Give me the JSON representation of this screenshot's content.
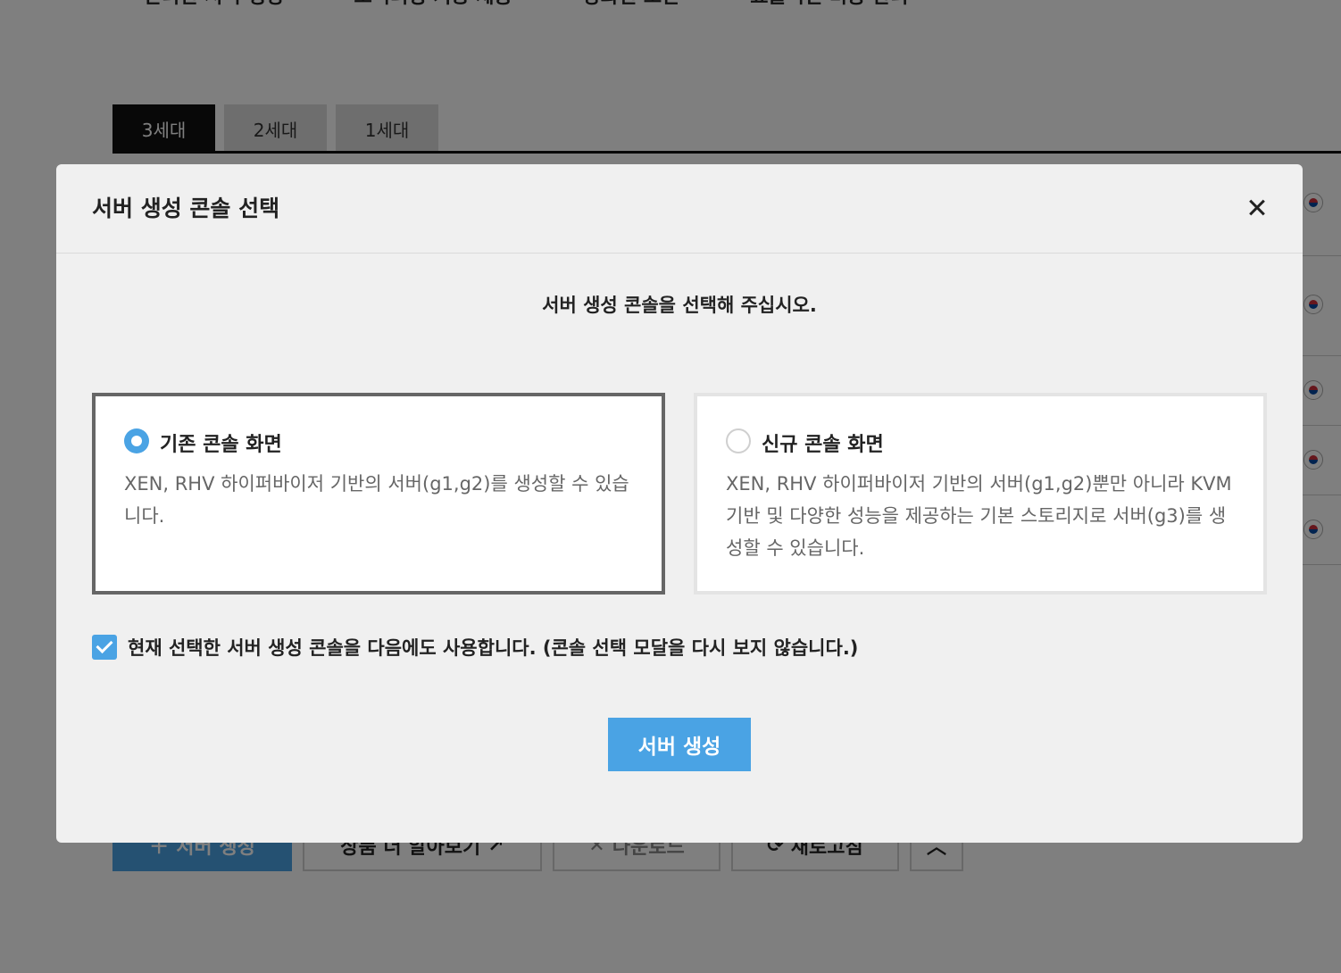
{
  "background": {
    "features": [
      "안리된 서버 생성",
      "오디터링 기능 제공",
      "강화된 보안",
      "효율적인 비용 관리"
    ],
    "tabs": [
      "3세대",
      "2세대",
      "1세대"
    ],
    "bottom_buttons": {
      "create": "서버 생성",
      "learn_more": "상품 더 알아보기",
      "download": "다운로드",
      "refresh": "새로고침"
    }
  },
  "modal": {
    "title": "서버 생성 콘솔 선택",
    "description": "서버 생성 콘솔을 선택해 주십시오.",
    "options": [
      {
        "title": "기존 콘솔 화면",
        "description": "XEN, RHV 하이퍼바이저 기반의 서버(g1,g2)를 생성할 수 있습니다.",
        "selected": true
      },
      {
        "title": "신규 콘솔 화면",
        "description": "XEN, RHV 하이퍼바이저 기반의 서버(g1,g2)뿐만 아니라 KVM 기반 및 다양한 성능을 제공하는 기본 스토리지로 서버(g3)를 생성할 수 있습니다.",
        "selected": false
      }
    ],
    "remember_label": "현재 선택한 서버 생성 콘솔을 다음에도 사용합니다. (콘솔 선택 모달을 다시 보지 않습니다.)",
    "remember_checked": true,
    "create_button": "서버 생성"
  },
  "colors": {
    "accent": "#4aa3e4",
    "overlay": "rgba(0,0,0,0.5)"
  }
}
